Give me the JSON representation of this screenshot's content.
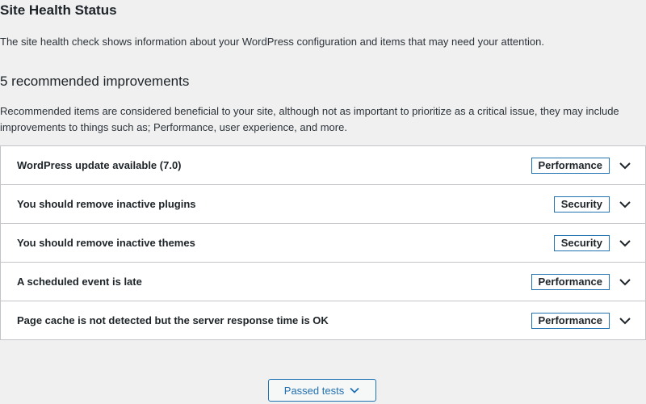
{
  "header": {
    "title": "Site Health Status",
    "intro": "The site health check shows information about your WordPress configuration and items that may need your attention."
  },
  "recommended": {
    "heading": "5 recommended improvements",
    "description": "Recommended items are considered beneficial to your site, although not as important to prioritize as a critical issue, they may include improvements to things such as; Performance, user experience, and more.",
    "items": [
      {
        "title": "WordPress update available (7.0)",
        "badge": "Performance"
      },
      {
        "title": "You should remove inactive plugins",
        "badge": "Security"
      },
      {
        "title": "You should remove inactive themes",
        "badge": "Security"
      },
      {
        "title": "A scheduled event is late",
        "badge": "Performance"
      },
      {
        "title": "Page cache is not detected but the server response time is OK",
        "badge": "Performance"
      }
    ]
  },
  "footer": {
    "passed_tests_label": "Passed tests"
  },
  "colors": {
    "accent": "#2271b1",
    "background": "#f0f0f1"
  },
  "icons": {
    "row_toggle": "chevron-down-icon",
    "passed_toggle": "chevron-down-icon"
  }
}
